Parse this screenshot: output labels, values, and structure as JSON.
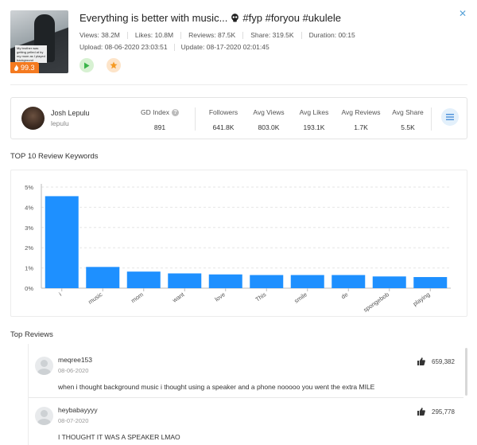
{
  "video": {
    "title": "Everything is better with music... ",
    "hashtags": "#fyp #foryou #ukulele",
    "thumbnail_caption": "My brother was getting yelled at by my mom as I played background",
    "score": "99.3",
    "stats": [
      {
        "label": "Views:",
        "value": "38.2M"
      },
      {
        "label": "Likes:",
        "value": "10.8M"
      },
      {
        "label": "Reviews:",
        "value": "87.5K"
      },
      {
        "label": "Share:",
        "value": "319.5K"
      },
      {
        "label": "Duration:",
        "value": "00:15"
      }
    ],
    "upload_label": "Upload:",
    "upload_value": "08-06-2020 23:03:51",
    "update_label": "Update:",
    "update_value": "08-17-2020 02:01:45"
  },
  "creator": {
    "name": "Josh Lepulu",
    "handle": "lepulu",
    "metrics": [
      {
        "label": "GD Index",
        "value": "891"
      },
      {
        "label": "Followers",
        "value": "641.8K"
      },
      {
        "label": "Avg Views",
        "value": "803.0K"
      },
      {
        "label": "Avg Likes",
        "value": "193.1K"
      },
      {
        "label": "Avg Reviews",
        "value": "1.7K"
      },
      {
        "label": "Avg Share",
        "value": "5.5K"
      }
    ]
  },
  "keywords_title": "TOP 10 Review Keywords",
  "reviews_title": "Top Reviews",
  "colors": {
    "bar": "#1e90ff",
    "accent": "#5aa3d8",
    "badge": "#f47a20"
  },
  "chart_data": {
    "type": "bar",
    "categories": [
      "i",
      "music",
      "mom",
      "want",
      "love",
      "This",
      "smile",
      "de",
      "spongebob",
      "playing"
    ],
    "values": [
      4.55,
      1.05,
      0.82,
      0.73,
      0.68,
      0.65,
      0.65,
      0.65,
      0.58,
      0.55
    ],
    "ylim": [
      0,
      5
    ],
    "yticks": [
      "0%",
      "1%",
      "2%",
      "3%",
      "4%",
      "5%"
    ],
    "grid": true
  },
  "reviews": [
    {
      "user": "meqree153",
      "date": "08-06-2020",
      "text": "when i thought background music i thought using a speaker and a phone nooooo you went the extra MILE",
      "likes": "659,382"
    },
    {
      "user": "heybabayyyy",
      "date": "08-07-2020",
      "text": "I THOUGHT IT WAS A SPEAKER LMAO",
      "likes": "295,778"
    }
  ]
}
